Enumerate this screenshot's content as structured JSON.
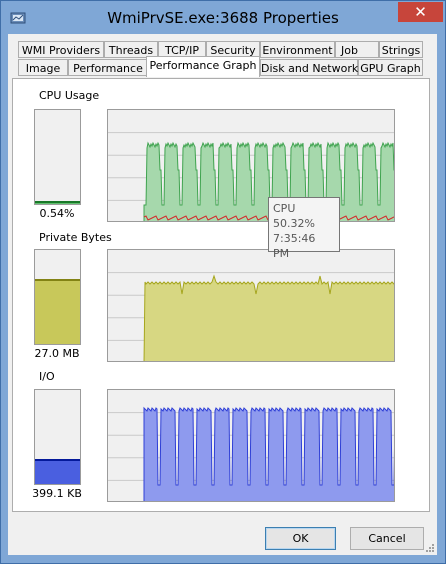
{
  "window": {
    "title": "WmiPrvSE.exe:3688 Properties",
    "close_glyph": "✕"
  },
  "tabs_row1": [
    {
      "label": "WMI Providers"
    },
    {
      "label": "Threads"
    },
    {
      "label": "TCP/IP"
    },
    {
      "label": "Security"
    },
    {
      "label": "Environment"
    },
    {
      "label": "Job"
    },
    {
      "label": "Strings"
    }
  ],
  "tabs_row2": [
    {
      "label": "Image"
    },
    {
      "label": "Performance"
    },
    {
      "label": "Performance Graph",
      "active": true
    },
    {
      "label": "Disk and Network"
    },
    {
      "label": "GPU Graph"
    }
  ],
  "cpu": {
    "label": "CPU Usage",
    "value": "0.54%",
    "level_percent": 0.54,
    "color": "#5fbf6e"
  },
  "private_bytes": {
    "label": "Private Bytes",
    "value": "27.0 MB",
    "level_percent": 67,
    "color": "#c8c85a"
  },
  "io": {
    "label": "I/O",
    "value": "399.1  KB",
    "level_percent": 25,
    "color": "#4a5fe0"
  },
  "tooltip": {
    "line1": "CPU",
    "line2": "50.32%",
    "line3": "7:35:46 PM"
  },
  "buttons": {
    "ok": "OK",
    "cancel": "Cancel"
  }
}
